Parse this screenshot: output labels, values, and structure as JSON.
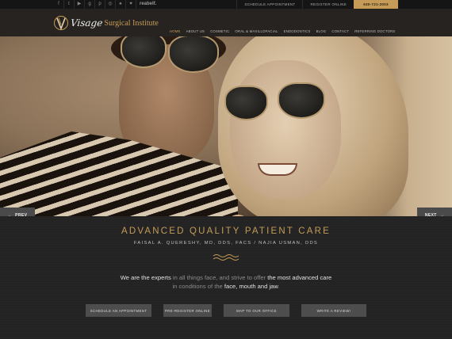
{
  "topbar": {
    "social_icons": [
      "facebook-icon",
      "twitter-icon",
      "youtube-icon",
      "google-plus-icon",
      "pinterest-icon",
      "instagram-icon",
      "foursquare-icon",
      "heart-icon"
    ],
    "social_glyphs": [
      "f",
      "t",
      "▶",
      "g",
      "p",
      "◎",
      "♠",
      "♥"
    ],
    "reabelf": "reabelf.",
    "schedule_link": "SCHEDULE APPOINTMENT",
    "register_link": "REGISTER ONLINE",
    "phone": "630-721-2003"
  },
  "header": {
    "logo_script": "Visage",
    "logo_text": "Surgical Institute",
    "nav": [
      {
        "label": "HOME",
        "active": true
      },
      {
        "label": "ABOUT US",
        "active": false
      },
      {
        "label": "COSMETIC",
        "active": false
      },
      {
        "label": "ORAL & MAXILLOFACIAL",
        "active": false
      },
      {
        "label": "ENDODONTICS",
        "active": false
      },
      {
        "label": "BLOG",
        "active": false
      },
      {
        "label": "CONTACT",
        "active": false
      },
      {
        "label": "REFERRING DOCTORS",
        "active": false
      }
    ]
  },
  "slider": {
    "prev_label": "PREV",
    "next_label": "NEXT",
    "prev_arrow": "←",
    "next_arrow": "→"
  },
  "content": {
    "tagline": "ADVANCED QUALITY PATIENT CARE",
    "doctors": "FAISAL A. QUERESHY, MD, DDS, FACS  /  NAJIA USMAN, DDS",
    "intro_parts": [
      "We are the experts",
      " in all things face, and strive to offer ",
      "the most advanced care",
      " in conditions of the ",
      "face, mouth and jaw",
      "."
    ],
    "buttons": [
      "SCHEDULE AN APPOINTMENT",
      "PRE-REGISTER ONLINE",
      "MAP TO OUR OFFICE",
      "WRITE A REVIEW!"
    ]
  },
  "colors": {
    "accent": "#c59b57",
    "bar": "#151515",
    "header": "#262320",
    "button": "#4d4d4d"
  }
}
